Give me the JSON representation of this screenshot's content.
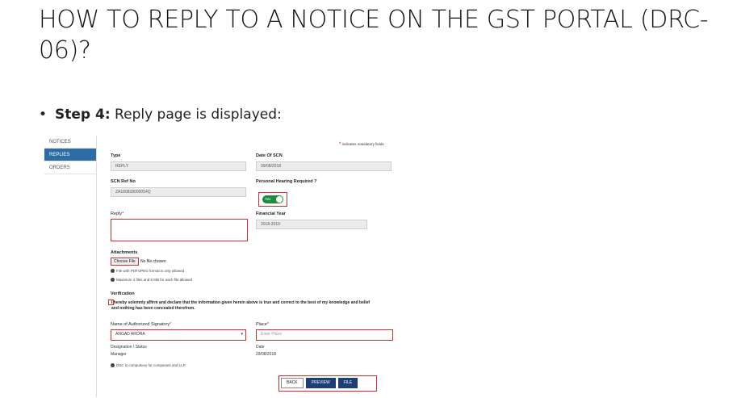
{
  "slide": {
    "title": "HOW TO REPLY TO A NOTICE ON THE GST PORTAL (DRC-06)?",
    "bullet_step": "Step 4:",
    "bullet_text": " Reply page is displayed:"
  },
  "sidebar": {
    "items": [
      {
        "label": "NOTICES",
        "active": false
      },
      {
        "label": "REPLIES",
        "active": true
      },
      {
        "label": "ORDERS",
        "active": false
      }
    ]
  },
  "form": {
    "mandatory_note": "indicates mandatory fields",
    "type_label": "Type",
    "type_value": "REPLY",
    "date_scn_label": "Date Of SCN",
    "date_scn_value": "09/08/2018",
    "scn_ref_label": "SCN Ref No",
    "scn_ref_value": "ZA180818000054Q",
    "hearing_label": "Personal Hearing Required ?",
    "hearing_toggle": "Yes",
    "reply_label": "Reply",
    "fy_label": "Financial Year",
    "fy_value": "2018-2019",
    "attachments_label": "Attachments",
    "choose_file": "Choose File",
    "no_file": "No file chosen",
    "info_format": "File with PDF/JPEG format is only allowed",
    "info_max": "Maximum 4 files and 5 MB for each file allowed",
    "verification_label": "Verification",
    "declaration": "I hereby solemnly affirm and declare that the information given herein above is true and correct to the best of my knowledge and belief and nothing has been concealed therefrom.",
    "signatory_label": "Name of Authorized Signatory",
    "signatory_value": "ANGAD ARORA",
    "place_label": "Place",
    "place_placeholder": "Enter Place",
    "designation_label": "Designation / Status",
    "designation_value": "Manager",
    "date_label": "Date",
    "date_value": "29/08/2018",
    "dsc_note": "DSC is compulsory for companies and LLP."
  },
  "buttons": {
    "back": "BACK",
    "preview": "PREVIEW",
    "file": "FILE"
  },
  "colors": {
    "highlight_red": "#c9302c",
    "sidebar_active": "#2e6da4",
    "toggle_green": "#1e8c3c",
    "primary_button": "#1f3e75"
  }
}
